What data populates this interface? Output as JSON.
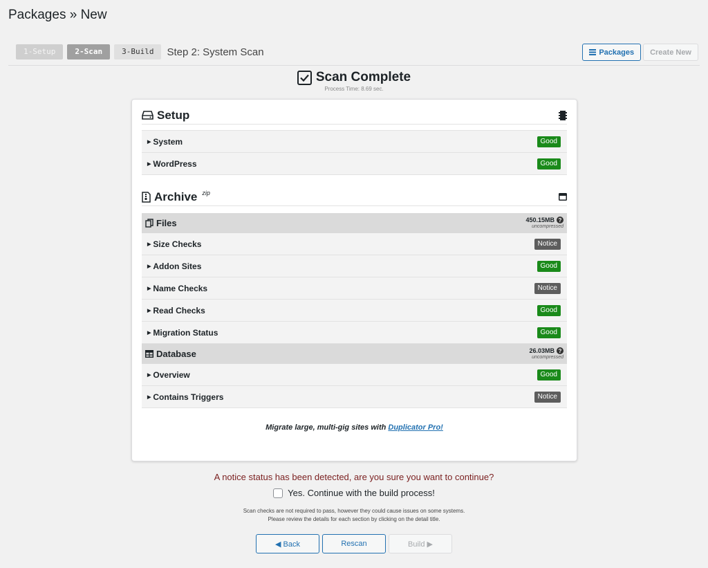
{
  "page": {
    "title": "Packages » New"
  },
  "wizard": {
    "steps": [
      {
        "label": "1-Setup",
        "state": "done"
      },
      {
        "label": "2-Scan",
        "state": "active"
      },
      {
        "label": "3-Build",
        "state": "todo"
      }
    ],
    "current_label": "Step 2: System Scan"
  },
  "top_buttons": {
    "packages": "Packages",
    "create_new": "Create New"
  },
  "scan": {
    "title": "Scan Complete",
    "process_time": "Process Time: 8.69 sec."
  },
  "setup": {
    "title": "Setup",
    "rows": [
      {
        "label": "System",
        "status": "Good"
      },
      {
        "label": "WordPress",
        "status": "Good"
      }
    ]
  },
  "archive": {
    "title": "Archive",
    "sup": "zip",
    "files": {
      "title": "Files",
      "size": "450.15MB",
      "size_note": "uncompressed",
      "rows": [
        {
          "label": "Size Checks",
          "status": "Notice"
        },
        {
          "label": "Addon Sites",
          "status": "Good"
        },
        {
          "label": "Name Checks",
          "status": "Notice"
        },
        {
          "label": "Read Checks",
          "status": "Good"
        },
        {
          "label": "Migration Status",
          "status": "Good"
        }
      ]
    },
    "database": {
      "title": "Database",
      "size": "26.03MB",
      "size_note": "uncompressed",
      "rows": [
        {
          "label": "Overview",
          "status": "Good"
        },
        {
          "label": "Contains Triggers",
          "status": "Notice"
        }
      ]
    }
  },
  "promo": {
    "text": "Migrate large, multi-gig sites with ",
    "link": "Duplicator Pro!"
  },
  "notice": {
    "message": "A notice status has been detected, are you sure you want to continue?",
    "confirm_label": "Yes. Continue with the build process!",
    "fine_line1": "Scan checks are not required to pass, however they could cause issues on some systems.",
    "fine_line2": "Please review the details for each section by clicking on the detail title."
  },
  "buttons": {
    "back": "◀ Back",
    "rescan": "Rescan",
    "build": "Build ▶"
  },
  "colors": {
    "good": "#1a8a1a",
    "notice": "#5d5d5d",
    "accent": "#2271b1"
  }
}
